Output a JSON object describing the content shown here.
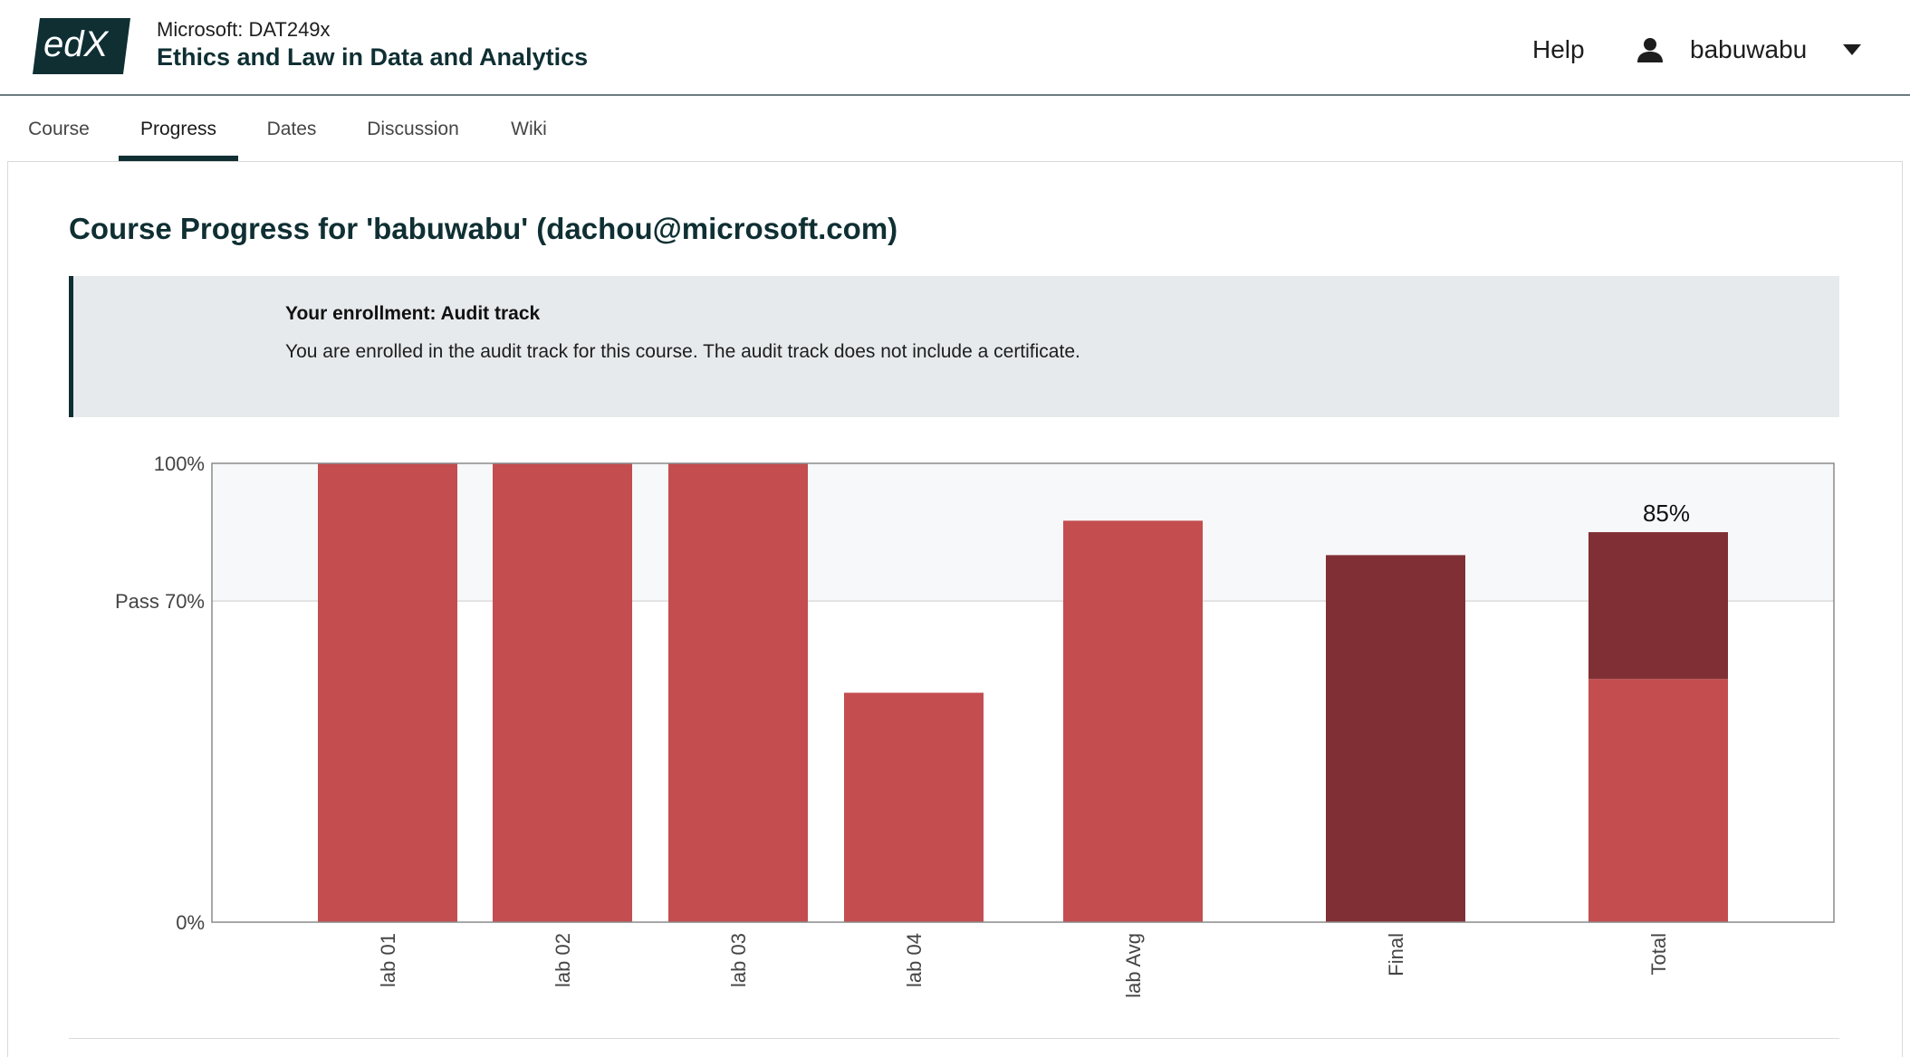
{
  "header": {
    "logo_text": "edX",
    "course_org": "Microsoft: DAT249x",
    "course_title": "Ethics and Law in Data and Analytics",
    "help_label": "Help",
    "username": "babuwabu",
    "user_icon": "person-icon",
    "menu_icon": "caret-down-icon"
  },
  "tabs": [
    {
      "label": "Course",
      "active": false
    },
    {
      "label": "Progress",
      "active": true
    },
    {
      "label": "Dates",
      "active": false
    },
    {
      "label": "Discussion",
      "active": false
    },
    {
      "label": "Wiki",
      "active": false
    }
  ],
  "main": {
    "title": "Course Progress for 'babuwabu' (dachou@microsoft.com)",
    "enrollment": {
      "heading": "Your enrollment: Audit track",
      "text": "You are enrolled in the audit track for this course. The audit track does not include a certificate."
    }
  },
  "colors": {
    "primary": "#0f2f33",
    "bar_light": "#c44d4f",
    "bar_dark": "#803035",
    "pass_band": "#f7f8fa"
  },
  "chart_data": {
    "type": "bar",
    "categories": [
      "lab 01",
      "lab 02",
      "lab 03",
      "lab 04",
      "lab Avg",
      "Final",
      "Total"
    ],
    "y_ticks": [
      {
        "value": 0,
        "label": "0%"
      },
      {
        "value": 70,
        "label": "Pass 70%"
      },
      {
        "value": 100,
        "label": "100%"
      }
    ],
    "ylim": [
      0,
      100
    ],
    "pass_threshold": 70,
    "bars": [
      {
        "category": "lab 01",
        "value": 100,
        "shade": "light"
      },
      {
        "category": "lab 02",
        "value": 100,
        "shade": "light"
      },
      {
        "category": "lab 03",
        "value": 100,
        "shade": "light"
      },
      {
        "category": "lab 04",
        "value": 50,
        "shade": "light"
      },
      {
        "category": "lab Avg",
        "value": 87.5,
        "shade": "light"
      },
      {
        "category": "Final",
        "value": 80,
        "shade": "dark"
      },
      {
        "category": "Total",
        "stack": [
          {
            "value": 53,
            "shade": "light"
          },
          {
            "value": 32,
            "shade": "dark"
          }
        ],
        "total": 85,
        "label": "85%"
      }
    ]
  }
}
